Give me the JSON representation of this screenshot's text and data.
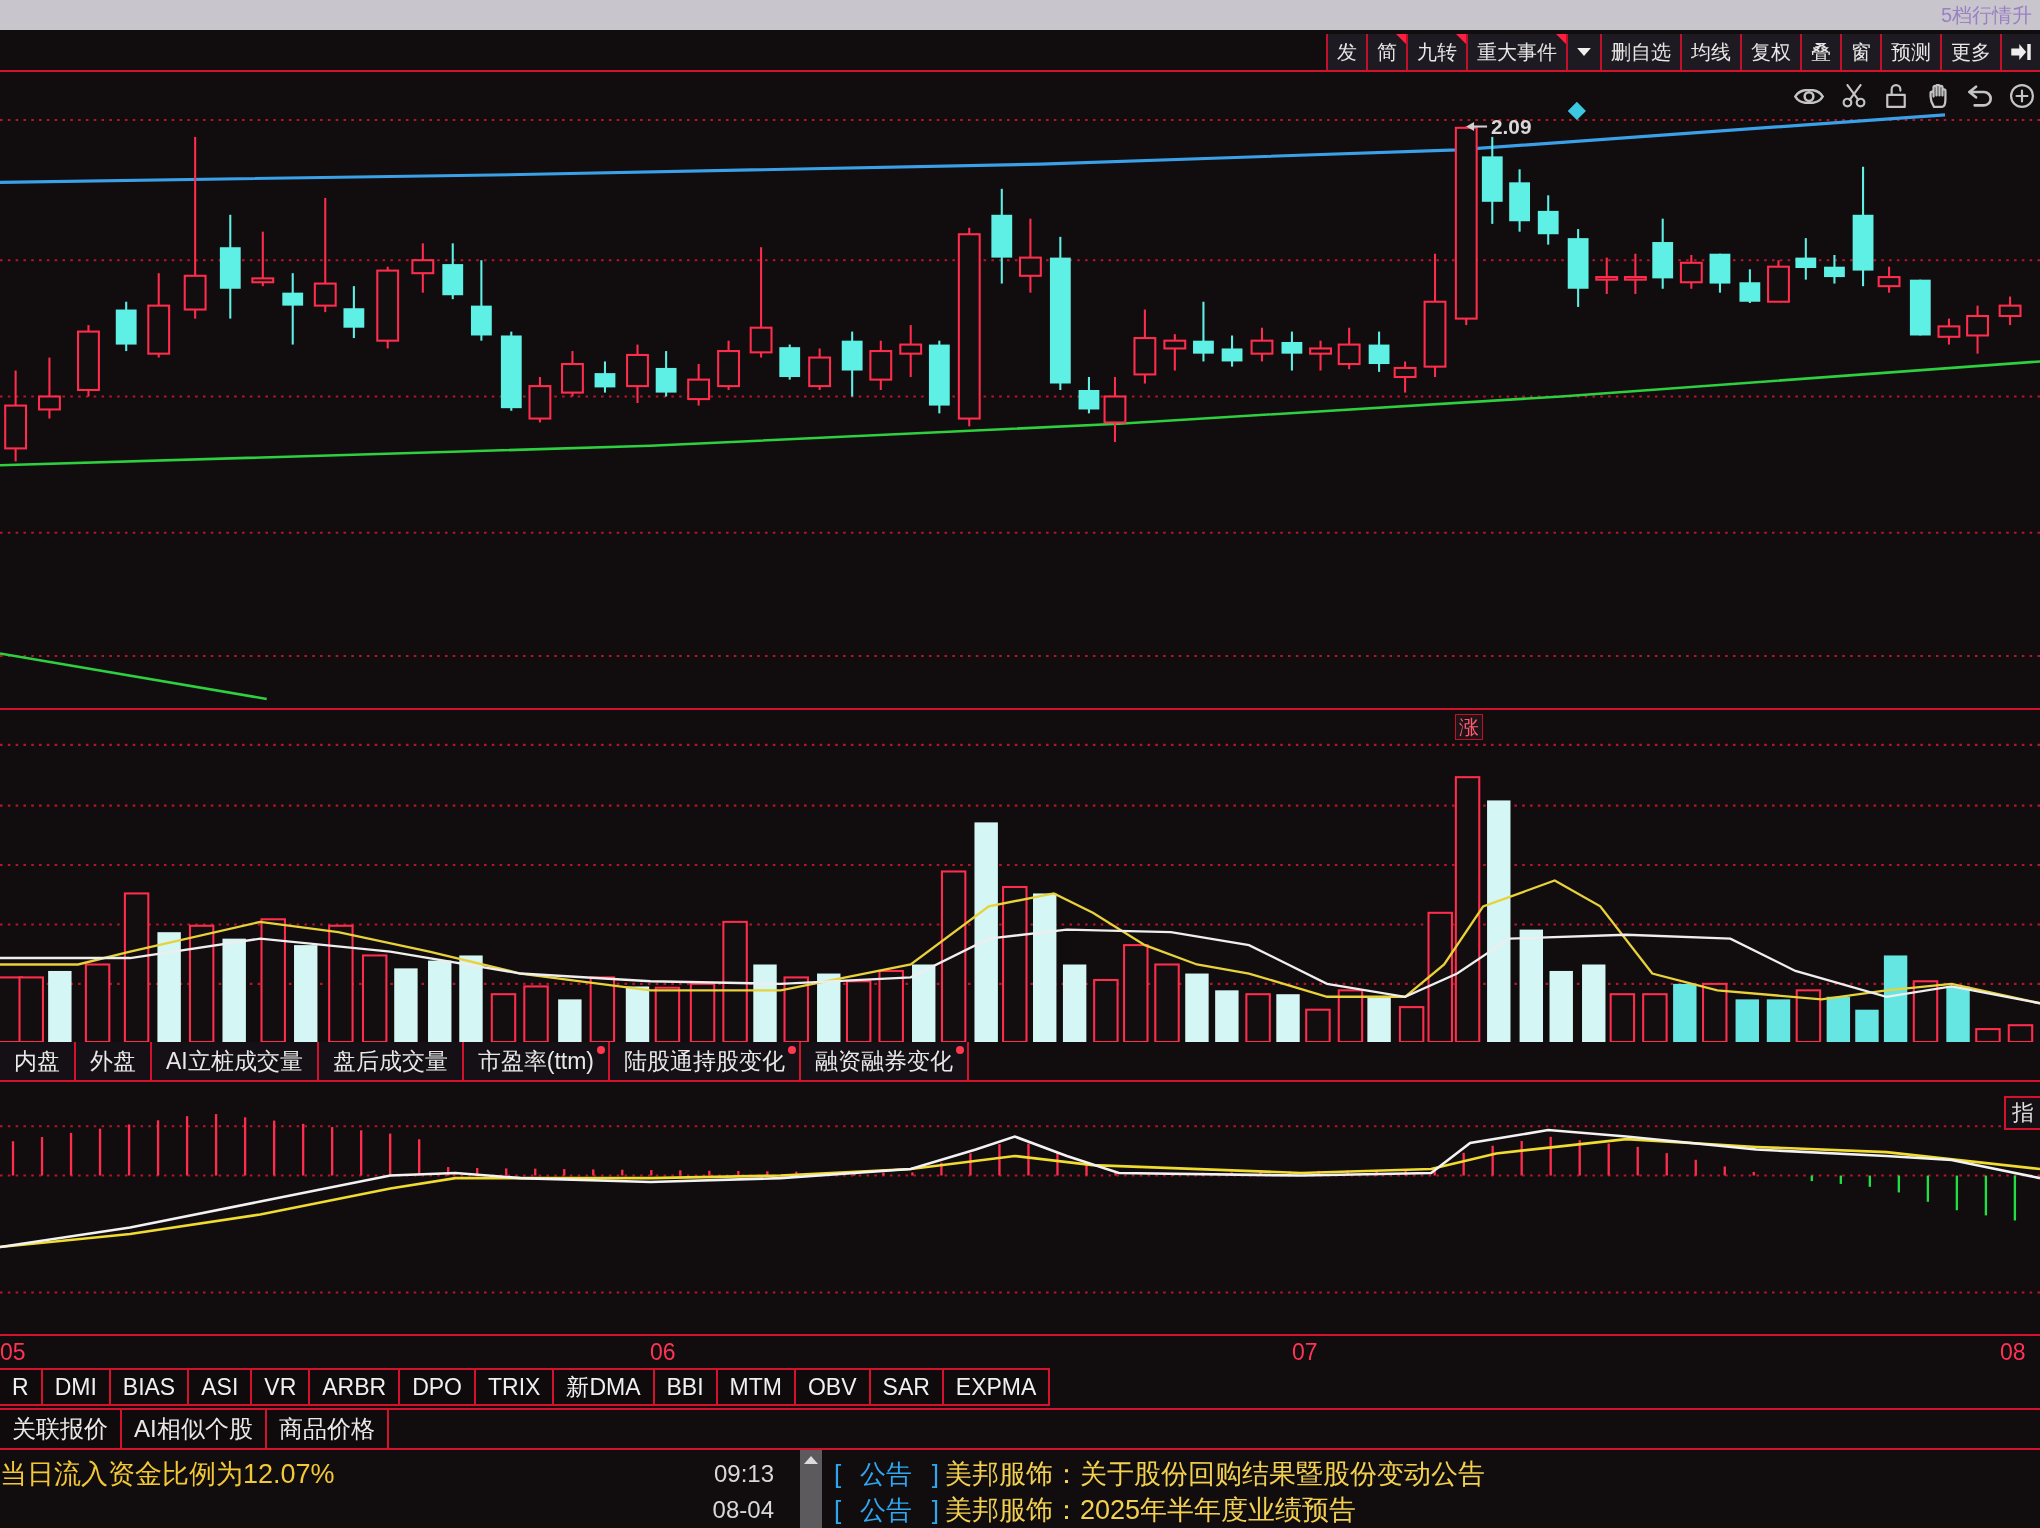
{
  "title_bar": {
    "text": "5档行情升"
  },
  "toolbar": [
    {
      "kind": "text",
      "label": "发",
      "flag": false
    },
    {
      "kind": "text",
      "label": "简",
      "flag": true
    },
    {
      "kind": "text",
      "label": "九转",
      "flag": true
    },
    {
      "kind": "text",
      "label": "重大事件",
      "flag": true
    },
    {
      "kind": "caret"
    },
    {
      "kind": "text",
      "label": "删自选",
      "flag": false
    },
    {
      "kind": "text",
      "label": "均线",
      "flag": false
    },
    {
      "kind": "text",
      "label": "复权",
      "flag": false
    },
    {
      "kind": "text",
      "label": "叠",
      "flag": false
    },
    {
      "kind": "text",
      "label": "窗",
      "flag": false
    },
    {
      "kind": "text",
      "label": "预测",
      "flag": false
    },
    {
      "kind": "text",
      "label": "更多",
      "flag": false
    },
    {
      "kind": "jump"
    }
  ],
  "price_chart": {
    "high_label": "2.09"
  },
  "volume_chart": {
    "marker": "涨"
  },
  "indicator_tabs": [
    {
      "label": "内盘",
      "selected": false,
      "dot": false
    },
    {
      "label": "外盘",
      "selected": false,
      "dot": false
    },
    {
      "label": "AI立桩成交量",
      "selected": false,
      "dot": false
    },
    {
      "label": "盘后成交量",
      "selected": false,
      "dot": false
    },
    {
      "label": "市盈率(ttm)",
      "selected": false,
      "dot": true
    },
    {
      "label": "陆股通持股变化",
      "selected": false,
      "dot": true
    },
    {
      "label": "融资融券变化",
      "selected": false,
      "dot": true
    }
  ],
  "macd_chart": {
    "side_button": "指"
  },
  "time_axis": [
    "05",
    "06",
    "07",
    "08"
  ],
  "indicator_buttons": [
    {
      "label": "R",
      "selected": false
    },
    {
      "label": "DMI",
      "selected": false
    },
    {
      "label": "BIAS",
      "selected": false
    },
    {
      "label": "ASI",
      "selected": false
    },
    {
      "label": "VR",
      "selected": false
    },
    {
      "label": "ARBR",
      "selected": false
    },
    {
      "label": "DPO",
      "selected": false
    },
    {
      "label": "TRIX",
      "selected": false
    },
    {
      "label": "新DMA",
      "selected": false
    },
    {
      "label": "BBI",
      "selected": false
    },
    {
      "label": "MTM",
      "selected": false
    },
    {
      "label": "OBV",
      "selected": false
    },
    {
      "label": "SAR",
      "selected": false
    },
    {
      "label": "EXPMA",
      "selected": false
    }
  ],
  "bottom_tabs": [
    {
      "label": "关联报价",
      "selected": false
    },
    {
      "label": "AI相似个股",
      "selected": false
    },
    {
      "label": "商品价格",
      "selected": false
    }
  ],
  "info_rows": [
    {
      "text": "当日流入资金比例为12.07%",
      "time": "09:13"
    },
    {
      "time": "08-04"
    }
  ],
  "news": [
    {
      "tag": "[ 公告 ]",
      "text": "美邦服饰：关于股份回购结果暨股份变动公告"
    },
    {
      "tag": "[ 公告 ]",
      "text": "美邦服饰：2025年半年度业绩预告"
    }
  ]
}
